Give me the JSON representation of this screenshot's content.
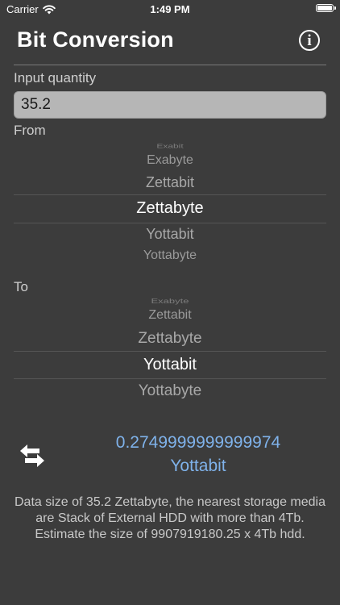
{
  "status_bar": {
    "carrier": "Carrier",
    "time": "1:49 PM"
  },
  "nav": {
    "title": "Bit Conversion",
    "info_icon": "info-circle-icon"
  },
  "input": {
    "label": "Input quantity",
    "value": "35.2"
  },
  "from_picker": {
    "label": "From",
    "items": [
      "Exabit",
      "Exabyte",
      "Zettabit",
      "Zettabyte",
      "Yottabit",
      "Yottabyte"
    ],
    "selected": "Zettabyte"
  },
  "to_picker": {
    "label": "To",
    "items": [
      "Exabyte",
      "Zettabit",
      "Zettabyte",
      "Yottabit",
      "Yottabyte"
    ],
    "selected": "Yottabit"
  },
  "result": {
    "swap_icon": "swap-arrows-icon",
    "value": "0.2749999999999974",
    "unit": "Yottabit",
    "color": "#7fb2ea"
  },
  "description": "Data size of 35.2 Zettabyte, the nearest storage media are Stack of External HDD with more than 4Tb. Estimate the size of 9907919180.25 x 4Tb hdd."
}
